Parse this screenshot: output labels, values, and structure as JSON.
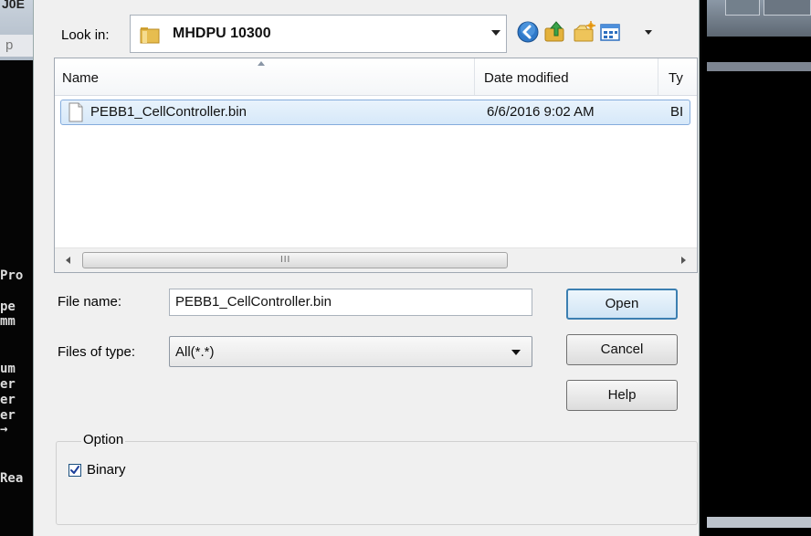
{
  "background": {
    "window_fragment_top": "J0E",
    "window_fragment_field": "p",
    "console_lines": [
      "Pro",
      "pe",
      "mm",
      "um",
      "er",
      "er",
      "er",
      "→",
      "Rea"
    ]
  },
  "dialog": {
    "look_in": {
      "label": "Look in:",
      "value": "MHDPU 10300"
    },
    "toolbar": {
      "back_icon": "back-arrow-icon",
      "up_icon": "up-folder-icon",
      "new_folder_icon": "new-folder-icon",
      "views_icon": "views-menu-icon"
    },
    "file_list": {
      "columns": [
        "Name",
        "Date modified",
        "Ty"
      ],
      "rows": [
        {
          "name": "PEBB1_CellController.bin",
          "date": "6/6/2016 9:02 AM",
          "type": "BI"
        }
      ],
      "scroll_grip": "III"
    },
    "file_name": {
      "label": "File name:",
      "value": "PEBB1_CellController.bin"
    },
    "file_type": {
      "label": "Files of type:",
      "value": "All(*.*)"
    },
    "buttons": {
      "open": "Open",
      "cancel": "Cancel",
      "help": "Help"
    },
    "option_group": {
      "title": "Option",
      "checkbox_label": "Binary",
      "checked": true
    },
    "colors": {
      "selection_bg": "#d6e8f9",
      "selection_border": "#84acdd",
      "dialog_bg": "#f0f0f0",
      "default_button_border": "#3c7fb1"
    }
  }
}
